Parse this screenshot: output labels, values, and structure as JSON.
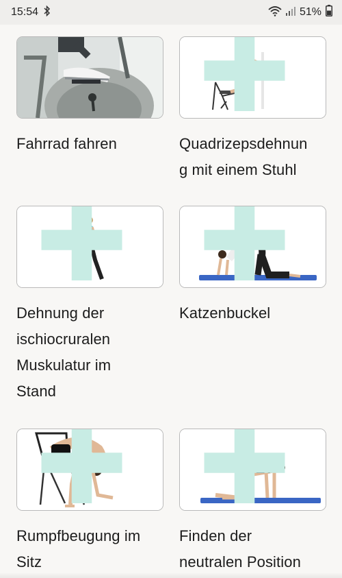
{
  "status_bar": {
    "time": "15:54",
    "battery_percent": "51%",
    "icons": [
      "bluetooth-icon",
      "wifi-icon",
      "signal-icon",
      "battery-icon"
    ]
  },
  "exercises": [
    {
      "title": "Fahrrad fahren",
      "image": "stationary-bike-photo"
    },
    {
      "title": "Quadrizepsdehnun\ng mit einem Stuhl",
      "image": "quadriceps-stretch-chair-photo"
    },
    {
      "title": "Dehnung der\nischiocruralen\nMuskulatur im\nStand",
      "image": "standing-hamstring-stretch-photo"
    },
    {
      "title": "Katzenbuckel",
      "image": "cat-stretch-photo"
    },
    {
      "title": "Rumpfbeugung im\nSitz",
      "image": "seated-trunk-flexion-photo"
    },
    {
      "title": "Finden der\nneutralen Position",
      "image": "neutral-position-photo"
    }
  ],
  "colors": {
    "accent_plus": "#c8ece4",
    "mat": "#3a66c4",
    "card_border": "#b9b9b9"
  }
}
